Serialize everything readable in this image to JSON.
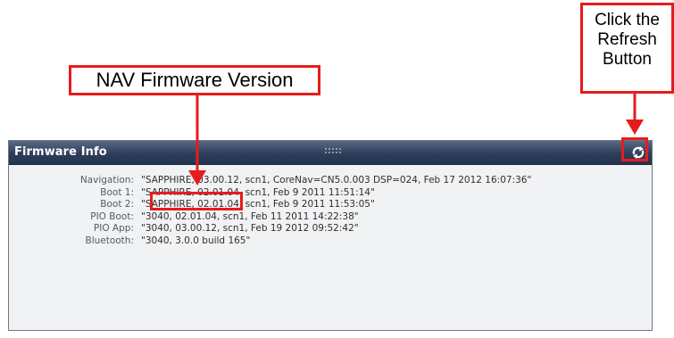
{
  "annotations": {
    "nav_callout": "NAV Firmware Version",
    "refresh_callout": [
      "Click the",
      "Refresh",
      "Button"
    ]
  },
  "panel": {
    "title": "Firmware Info",
    "rows": [
      {
        "label": "Navigation:",
        "value": "\"SAPPHIRE, 03.00.12, scn1, CoreNav=CN5.0.003 DSP=024, Feb 17 2012 16:07:36\""
      },
      {
        "label": "Boot 1:",
        "value": "\"SAPPHIRE, 02.01.04, scn1, Feb 9 2011 11:51:14\""
      },
      {
        "label": "Boot 2:",
        "value": "\"SAPPHIRE, 02.01.04, scn1, Feb 9 2011 11:53:05\""
      },
      {
        "label": "PIO Boot:",
        "value": "\"3040, 02.01.04, scn1, Feb 11 2011 14:22:38\""
      },
      {
        "label": "PIO App:",
        "value": "\"3040, 03.00.12, scn1, Feb 19 2012 09:52:42\""
      },
      {
        "label": "Bluetooth:",
        "value": "\"3040, 3.0.0 build 165\""
      }
    ]
  },
  "icons": {
    "refresh": "refresh-icon",
    "grip": "drag-grip-icon"
  },
  "colors": {
    "callout_red": "#e61c1c",
    "header_blue": "#2e3d59",
    "panel_bg": "#f1f2f4"
  }
}
